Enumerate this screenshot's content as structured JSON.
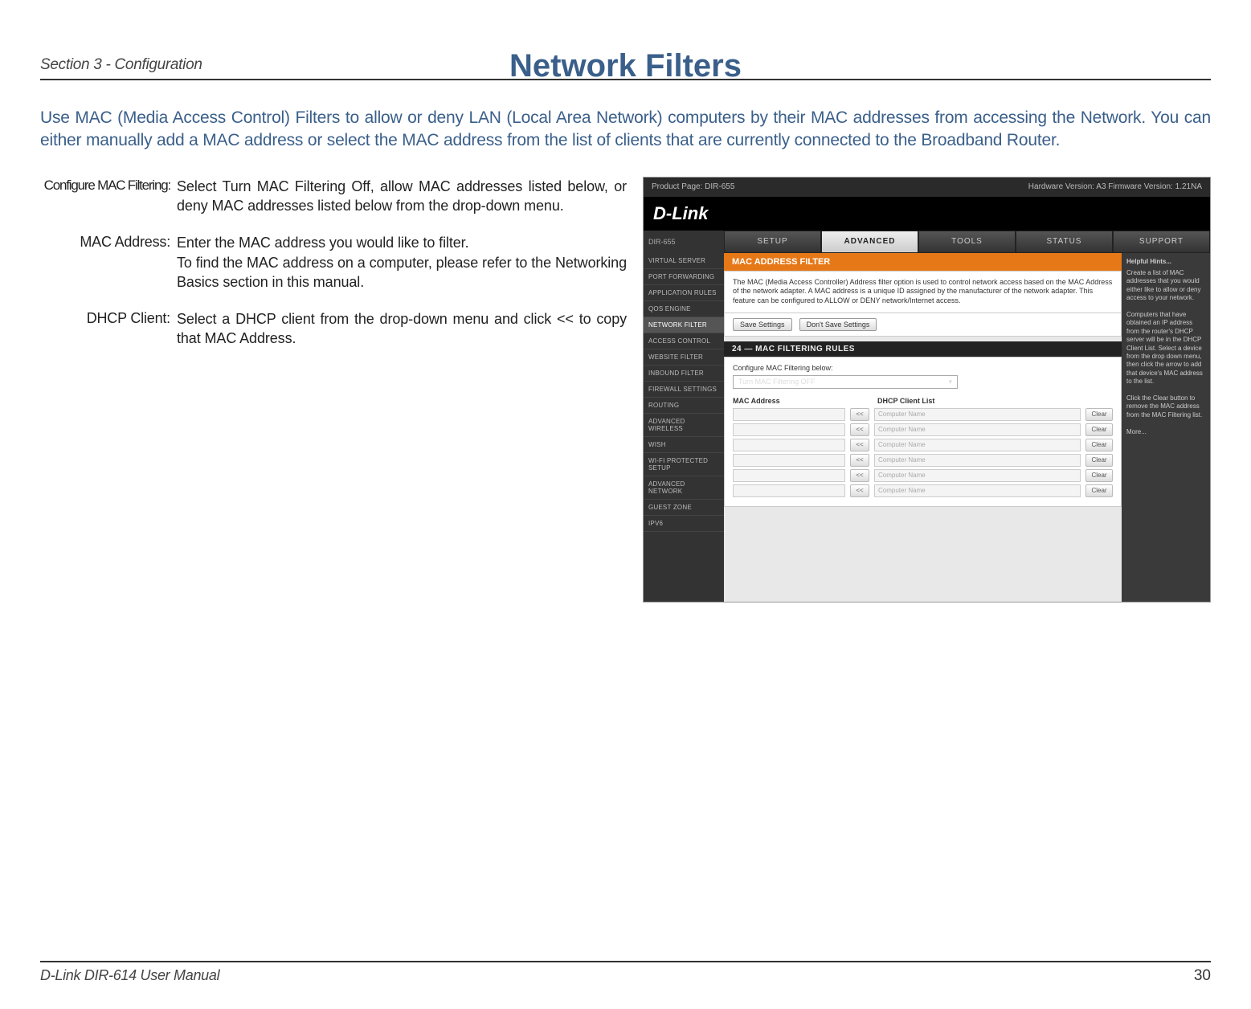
{
  "header": {
    "section": "Section 3 - Configuration"
  },
  "title": "Network Filters",
  "intro": "Use MAC (Media Access Control) Filters to allow or deny LAN (Local Area Network) computers by their MAC addresses from accessing the Network. You can either manually add a MAC address or select the MAC address from the list of clients that are currently connected to the Broadband Router.",
  "defs": [
    {
      "label": "Configure MAC Filtering:",
      "text": "Select Turn MAC Filtering Off, allow MAC addresses listed below, or deny MAC addresses listed below from the drop-down menu."
    },
    {
      "label": "MAC Address:",
      "text": "Enter the MAC address you would like to filter.\nTo find the MAC address on a computer, please refer to the Networking Basics section in this manual."
    },
    {
      "label": "DHCP Client:",
      "text": "Select a DHCP client from the drop-down menu and click << to copy that MAC Address."
    }
  ],
  "screenshot": {
    "topbar": {
      "left": "Product Page: DIR-655",
      "right": "Hardware Version: A3   Firmware Version: 1.21NA"
    },
    "logo": "D-Link",
    "prod": "DIR-655",
    "tabs": [
      "SETUP",
      "ADVANCED",
      "TOOLS",
      "STATUS",
      "SUPPORT"
    ],
    "active_tab": 1,
    "side": [
      "VIRTUAL SERVER",
      "PORT FORWARDING",
      "APPLICATION RULES",
      "QOS ENGINE",
      "NETWORK FILTER",
      "ACCESS CONTROL",
      "WEBSITE FILTER",
      "INBOUND FILTER",
      "FIREWALL SETTINGS",
      "ROUTING",
      "ADVANCED WIRELESS",
      "WISH",
      "WI-FI PROTECTED SETUP",
      "ADVANCED NETWORK",
      "GUEST ZONE",
      "IPV6"
    ],
    "side_sel": 4,
    "panel_title": "MAC ADDRESS FILTER",
    "panel_desc": "The MAC (Media Access Controller) Address filter option is used to control network access based on the MAC Address of the network adapter. A MAC address is a unique ID assigned by the manufacturer of the network adapter. This feature can be configured to ALLOW or DENY network/Internet access.",
    "save": "Save Settings",
    "dont": "Don't Save Settings",
    "rules_title": "24 — MAC FILTERING RULES",
    "rules_label": "Configure MAC Filtering below:",
    "select_val": "Turn MAC Filtering OFF",
    "col1": "MAC Address",
    "col2": "DHCP Client List",
    "arrow": "<<",
    "placeholder": "Computer Name",
    "clear": "Clear",
    "hints_title": "Helpful Hints...",
    "hints_body": "Create a list of MAC addresses that you would either like to allow or deny access to your network.\n\nComputers that have obtained an IP address from the router's DHCP server will be in the DHCP Client List. Select a device from the drop down menu, then click the arrow to add that device's MAC address to the list.\n\nClick the Clear button to remove the MAC address from the MAC Filtering list.\n\nMore..."
  },
  "footer": {
    "manual": "D-Link DIR-614 User Manual",
    "page": "30"
  }
}
